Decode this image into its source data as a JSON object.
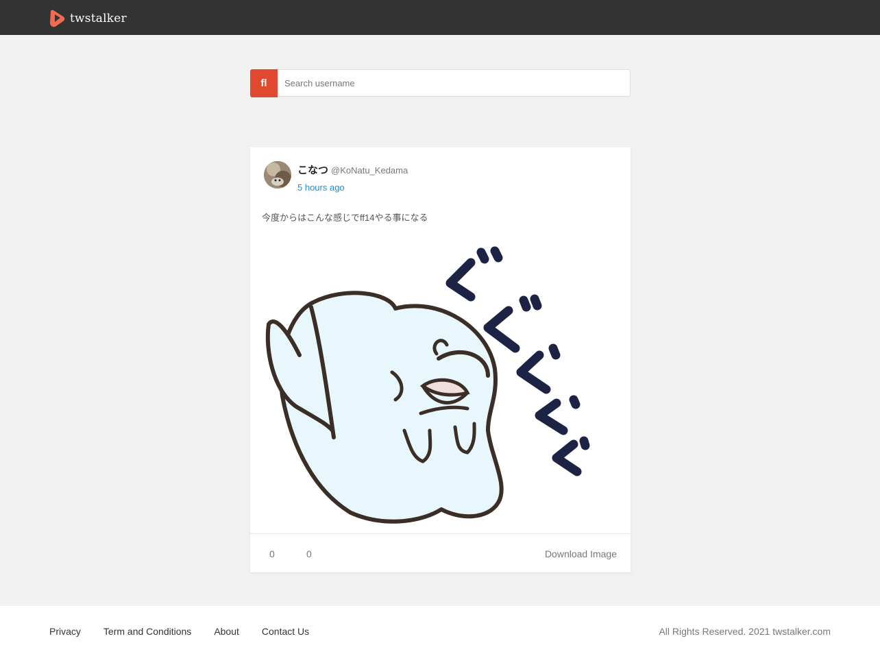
{
  "header": {
    "site_name": "twstalker",
    "brand_color": "#f26b4f"
  },
  "search": {
    "button_icon": "ﬂ",
    "button_icon_name": "search-icon",
    "placeholder": "Search username"
  },
  "tweet": {
    "display_name": "こなつ",
    "handle": "@KoNatu_Kedama",
    "time": "5 hours ago",
    "text": "今度からはこんな感じでff14やる事になる",
    "replies": "0",
    "retweets": "0",
    "download_label": "Download Image",
    "reply_icon": "",
    "retweet_icon": "",
    "download_icon": ""
  },
  "footer": {
    "links": [
      "Privacy",
      "Term and Conditions",
      "About",
      "Contact Us"
    ],
    "copyright": "All Rights Reserved.  2021 twstalker.com"
  }
}
